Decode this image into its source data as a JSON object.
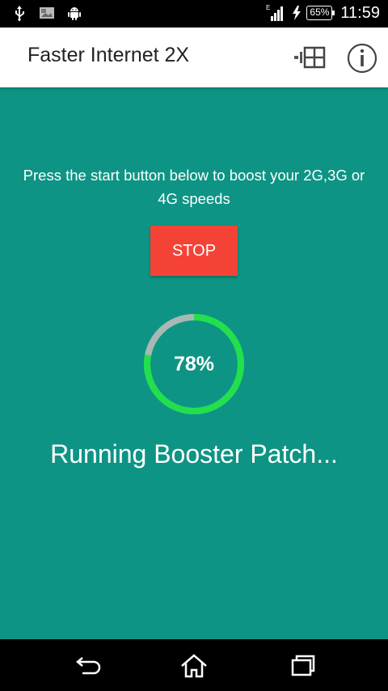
{
  "status_bar": {
    "time": "11:59",
    "battery": "65%",
    "network_type": "E",
    "icons": [
      "usb-icon",
      "image-notification-icon",
      "android-icon",
      "signal-icon",
      "charging-icon",
      "battery-icon"
    ]
  },
  "app_bar": {
    "title": "Faster Internet 2X",
    "icons": [
      "grid-icon",
      "info-icon"
    ]
  },
  "main": {
    "background_color": "#0E9484",
    "instructions": "Press the start button below to boost your 2G,3G or 4G speeds",
    "stop_label": "STOP",
    "stop_color": "#F44336",
    "progress": {
      "value": 78,
      "label": "78%",
      "ring_color": "#21E04C",
      "track_color": "#A8B8B2"
    },
    "status": "Running Booster Patch..."
  },
  "nav_bar": {
    "icons": [
      "back-icon",
      "home-icon",
      "recent-apps-icon"
    ]
  }
}
